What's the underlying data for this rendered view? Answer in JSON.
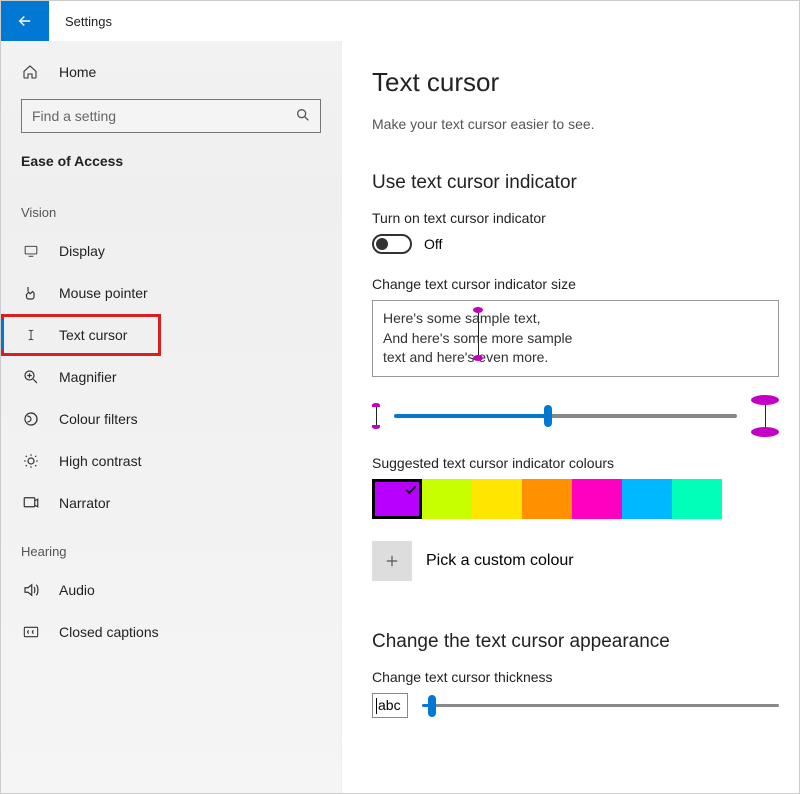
{
  "titlebar": {
    "title": "Settings"
  },
  "sidebar": {
    "home": "Home",
    "search_placeholder": "Find a setting",
    "section": "Ease of Access",
    "groups": [
      {
        "label": "Vision",
        "items": [
          {
            "id": "display",
            "label": "Display"
          },
          {
            "id": "mouse-pointer",
            "label": "Mouse pointer"
          },
          {
            "id": "text-cursor",
            "label": "Text cursor",
            "selected": true,
            "highlight": true
          },
          {
            "id": "magnifier",
            "label": "Magnifier"
          },
          {
            "id": "colour-filters",
            "label": "Colour filters"
          },
          {
            "id": "high-contrast",
            "label": "High contrast"
          },
          {
            "id": "narrator",
            "label": "Narrator"
          }
        ]
      },
      {
        "label": "Hearing",
        "items": [
          {
            "id": "audio",
            "label": "Audio"
          },
          {
            "id": "closed-captions",
            "label": "Closed captions"
          }
        ]
      }
    ]
  },
  "content": {
    "title": "Text cursor",
    "subtitle": "Make your text cursor easier to see.",
    "section1": {
      "heading": "Use text cursor indicator",
      "toggle_label": "Turn on text cursor indicator",
      "toggle_state": "Off",
      "size_label": "Change text cursor indicator size",
      "preview_line1": "Here's some sample text,",
      "preview_line2": "And here's some more sample",
      "preview_line3": "text and here's even more.",
      "colours_label": "Suggested text cursor indicator colours",
      "colours": [
        "#b800ff",
        "#c8ff00",
        "#ffe600",
        "#ff9000",
        "#ff00c0",
        "#00b8ff",
        "#00ffb8"
      ],
      "custom_label": "Pick a custom colour"
    },
    "section2": {
      "heading": "Change the text cursor appearance",
      "thickness_label": "Change text cursor thickness",
      "abc": "abc"
    }
  }
}
